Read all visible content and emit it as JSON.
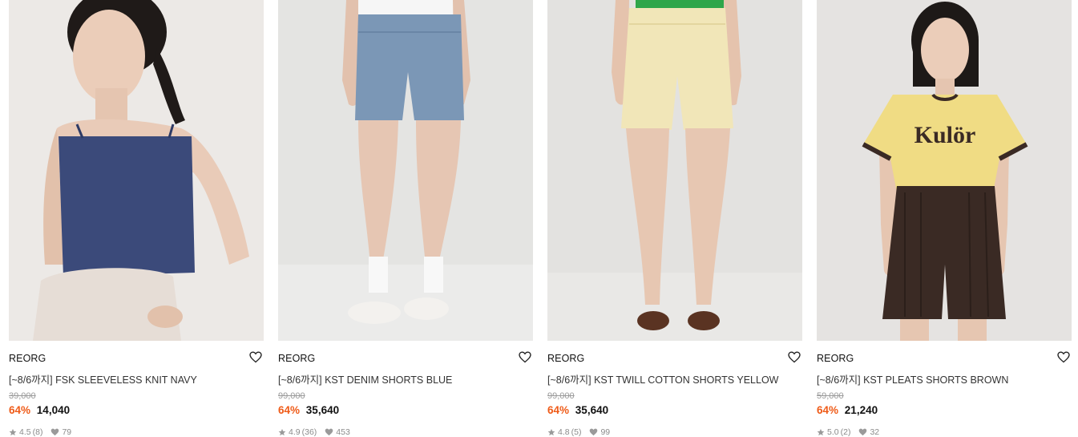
{
  "products": [
    {
      "brand": "REORG",
      "name": "[~8/6까지] FSK SLEEVELESS KNIT NAVY",
      "original_price": "39,000",
      "discount": "64%",
      "sale_price": "14,040",
      "rating": "4.5",
      "review_count": "(8)",
      "likes": "79",
      "image_icon": "product-photo-navy-knit-top",
      "colors": {
        "bg": "#ece9e6",
        "top": "#3b4a7a",
        "bottom": "#e6ddd6",
        "skin": "#e9cbb8"
      }
    },
    {
      "brand": "REORG",
      "name": "[~8/6까지] KST DENIM SHORTS BLUE",
      "original_price": "99,000",
      "discount": "64%",
      "sale_price": "35,640",
      "rating": "4.9",
      "review_count": "(36)",
      "likes": "453",
      "image_icon": "product-photo-denim-shorts",
      "colors": {
        "bg": "#e4e4e2",
        "top": "#f4f4f4",
        "bottom": "#7b97b6",
        "skin": "#e2c1ad"
      }
    },
    {
      "brand": "REORG",
      "name": "[~8/6까지] KST TWILL COTTON SHORTS YELLOW",
      "original_price": "99,000",
      "discount": "64%",
      "sale_price": "35,640",
      "rating": "4.8",
      "review_count": "(5)",
      "likes": "99",
      "image_icon": "product-photo-yellow-shorts",
      "colors": {
        "bg": "#e3e2e0",
        "top": "#2fa64a",
        "bottom": "#f1e6b8",
        "skin": "#e5c3ad"
      }
    },
    {
      "brand": "REORG",
      "name": "[~8/6까지] KST PLEATS SHORTS BROWN",
      "original_price": "59,000",
      "discount": "64%",
      "sale_price": "21,240",
      "rating": "5.0",
      "review_count": "(2)",
      "likes": "32",
      "image_icon": "product-photo-brown-pleats-shorts",
      "tee_print": "Kulör",
      "colors": {
        "bg": "#e5e3e1",
        "top": "#f0dc84",
        "bottom": "#3a2a24",
        "skin": "#e9cbb8"
      }
    }
  ],
  "accent_color": "#ef5b18"
}
